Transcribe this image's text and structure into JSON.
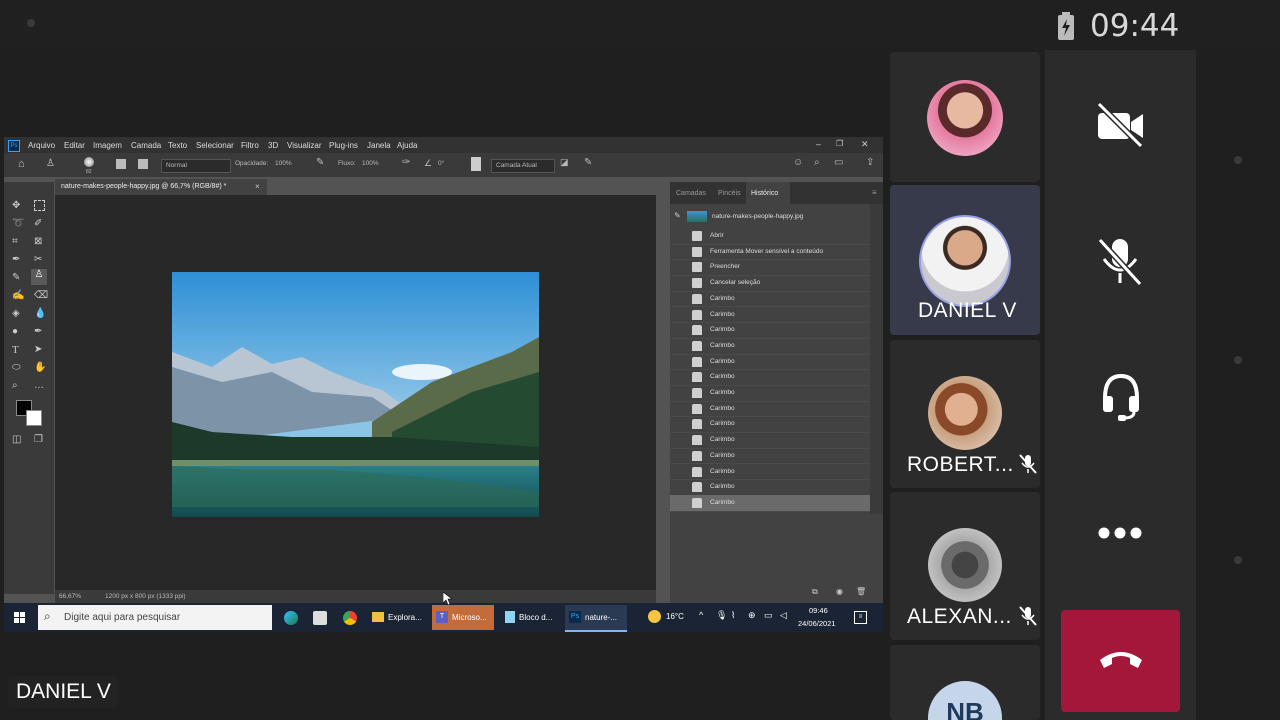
{
  "status_bar": {
    "time": "09:44"
  },
  "photoshop": {
    "menu": [
      "Arquivo",
      "Editar",
      "Imagem",
      "Camada",
      "Texto",
      "Selecionar",
      "Filtro",
      "3D",
      "Visualizar",
      "Plug-ins",
      "Janela",
      "Ajuda"
    ],
    "options": {
      "brush_size": "82",
      "mode": "Normal",
      "opacity_label": "Opacidade:",
      "opacity_value": "100%",
      "flow_label": "Fluxo:",
      "flow_value": "100%",
      "angle_value": "0°",
      "sample": "Camada Atual"
    },
    "document_tab": "nature-makes-people-happy.jpg @ 66,7% (RGB/8#) *",
    "status": {
      "zoom": "66,67%",
      "dimensions": "1200 px x 800 px (1333 ppi)"
    },
    "panel_tabs": [
      "Camadas",
      "Pincéis",
      "Histórico"
    ],
    "history_snapshot": "nature-makes-people-happy.jpg",
    "history": [
      "Abrir",
      "Ferramenta Mover sensível a conteúdo",
      "Preencher",
      "Cancelar seleção",
      "Carimbo",
      "Carimbo",
      "Carimbo",
      "Carimbo",
      "Carimbo",
      "Carimbo",
      "Carimbo",
      "Carimbo",
      "Carimbo",
      "Carimbo",
      "Carimbo",
      "Carimbo",
      "Carimbo",
      "Carimbo"
    ]
  },
  "taskbar": {
    "search_placeholder": "Digite aqui para pesquisar",
    "apps": [
      "Explora...",
      "Microso...",
      "Bloco d...",
      "nature-..."
    ],
    "weather": "16°C",
    "clock_time": "09:46",
    "clock_date": "24/06/2021"
  },
  "participants": [
    {
      "name": ""
    },
    {
      "name": "DANIEL V"
    },
    {
      "name": "ROBERT..."
    },
    {
      "name": "ALEXAN..."
    },
    {
      "name": "NB"
    }
  ],
  "presenter_label": "DANIEL V",
  "colors": {
    "accent_ring": "#9aa0e6",
    "hangup": "#a4163a"
  }
}
